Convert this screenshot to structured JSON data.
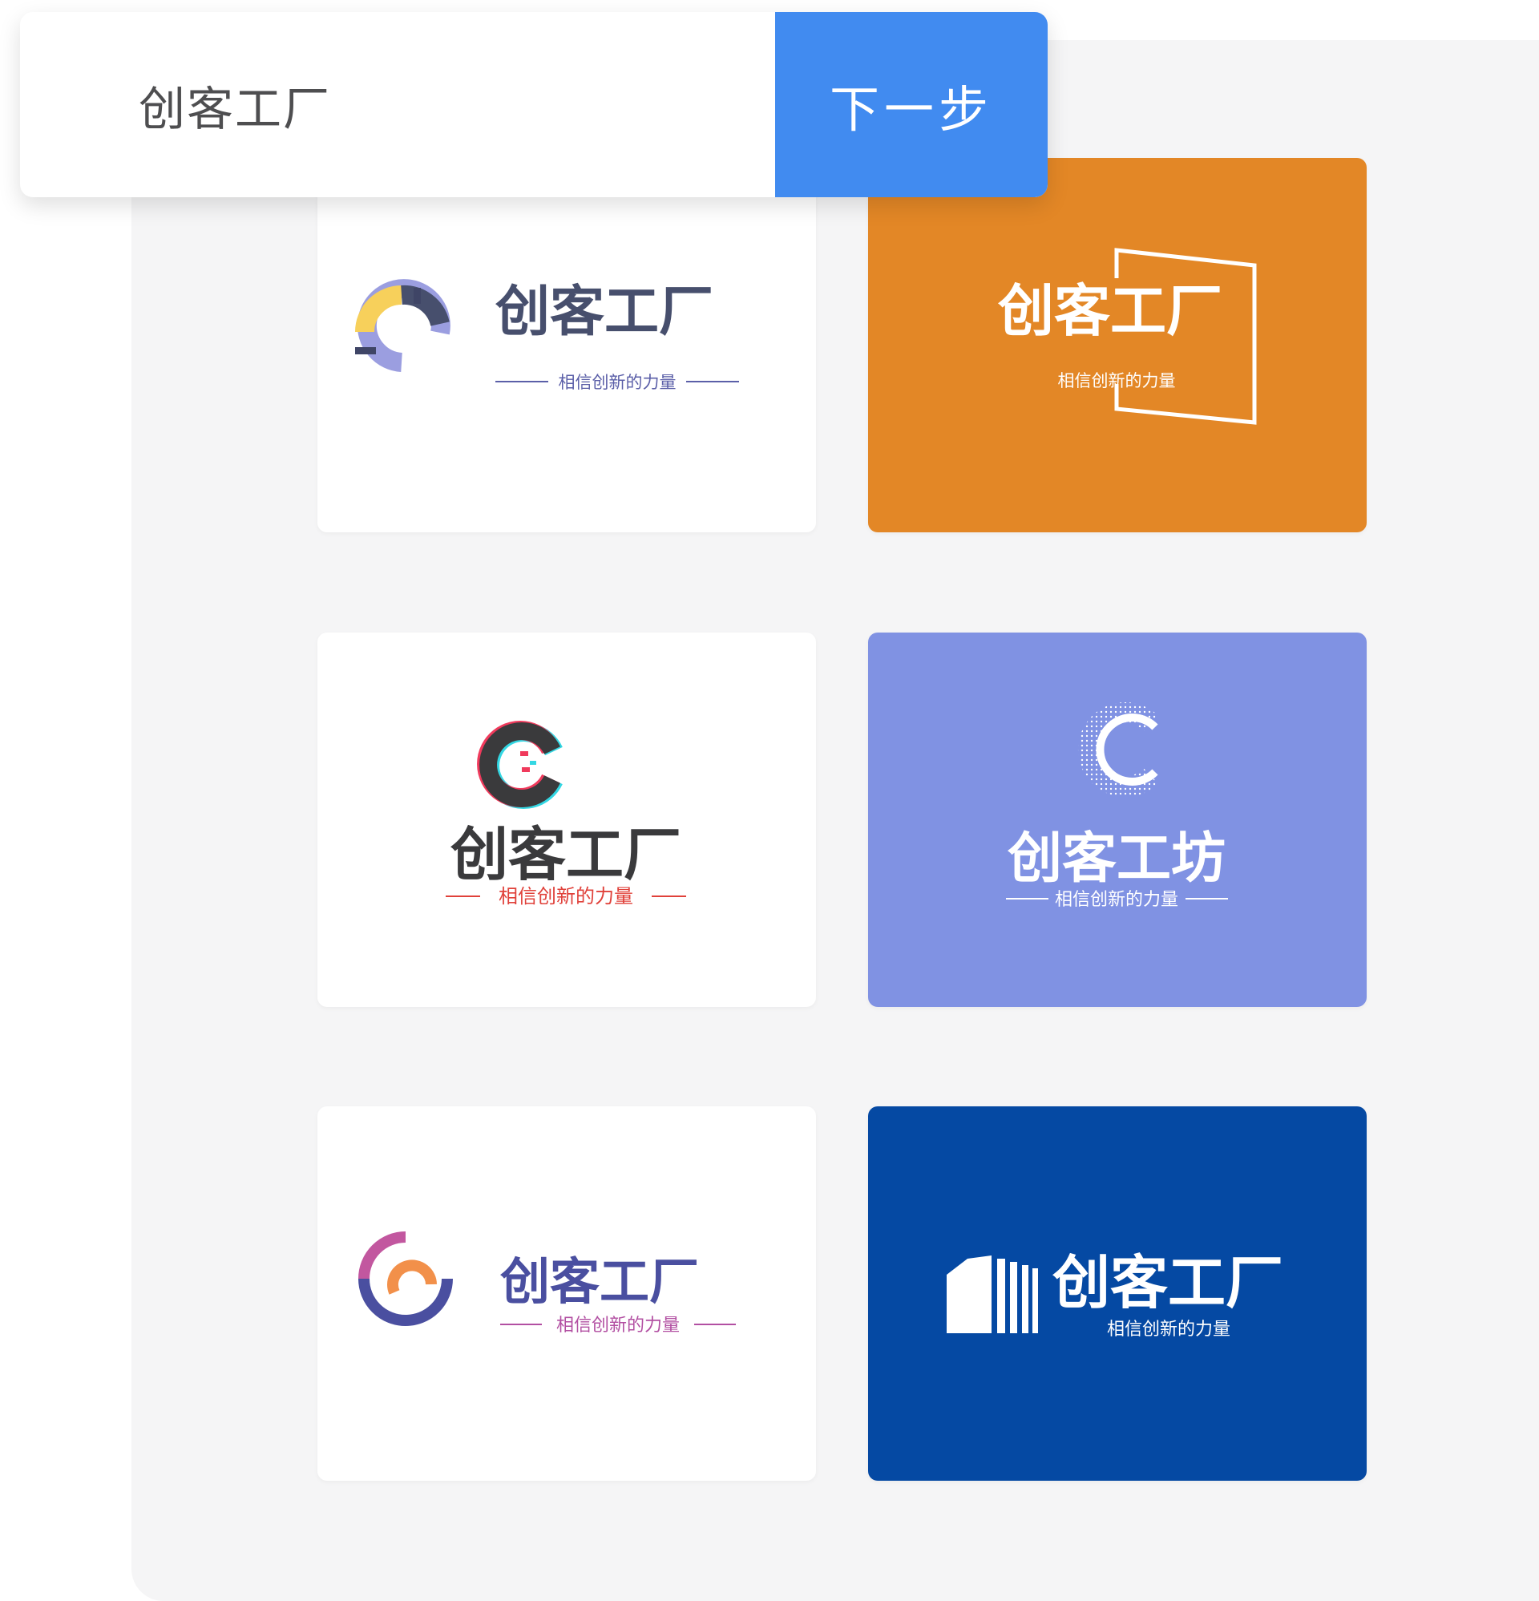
{
  "search": {
    "value": "创客工厂"
  },
  "next_button": {
    "label": "下一步"
  },
  "logos": [
    {
      "name": "创客工厂",
      "tagline": "相信创新的力量",
      "background": "#ffffff",
      "text_color": "#474f6d",
      "tagline_color": "#5b5fa8",
      "accent_colors": [
        "#f7d05b",
        "#9b9ee0",
        "#3f4566"
      ]
    },
    {
      "name": "创客工厂",
      "tagline": "相信创新的力量",
      "background": "#e38726",
      "text_color": "#ffffff",
      "tagline_color": "#ffffff"
    },
    {
      "name": "创客工厂",
      "tagline": "相信创新的力量",
      "background": "#ffffff",
      "text_color": "#3a3a3c",
      "tagline_color": "#e0413a",
      "accent_colors": [
        "#f03a5c",
        "#33d7e3"
      ]
    },
    {
      "name": "创客工坊",
      "tagline": "相信创新的力量",
      "background": "#8092e3",
      "text_color": "#ffffff",
      "tagline_color": "#ffffff"
    },
    {
      "name": "创客工厂",
      "tagline": "相信创新的力量",
      "background": "#ffffff",
      "text_color": "#4a4fa0",
      "tagline_color": "#b24fa2",
      "accent_colors": [
        "#c2579f",
        "#f2904a",
        "#4a4fa0"
      ]
    },
    {
      "name": "创客工厂",
      "tagline": "相信创新的力量",
      "background": "#0549a3",
      "text_color": "#ffffff",
      "tagline_color": "#ffffff"
    }
  ]
}
